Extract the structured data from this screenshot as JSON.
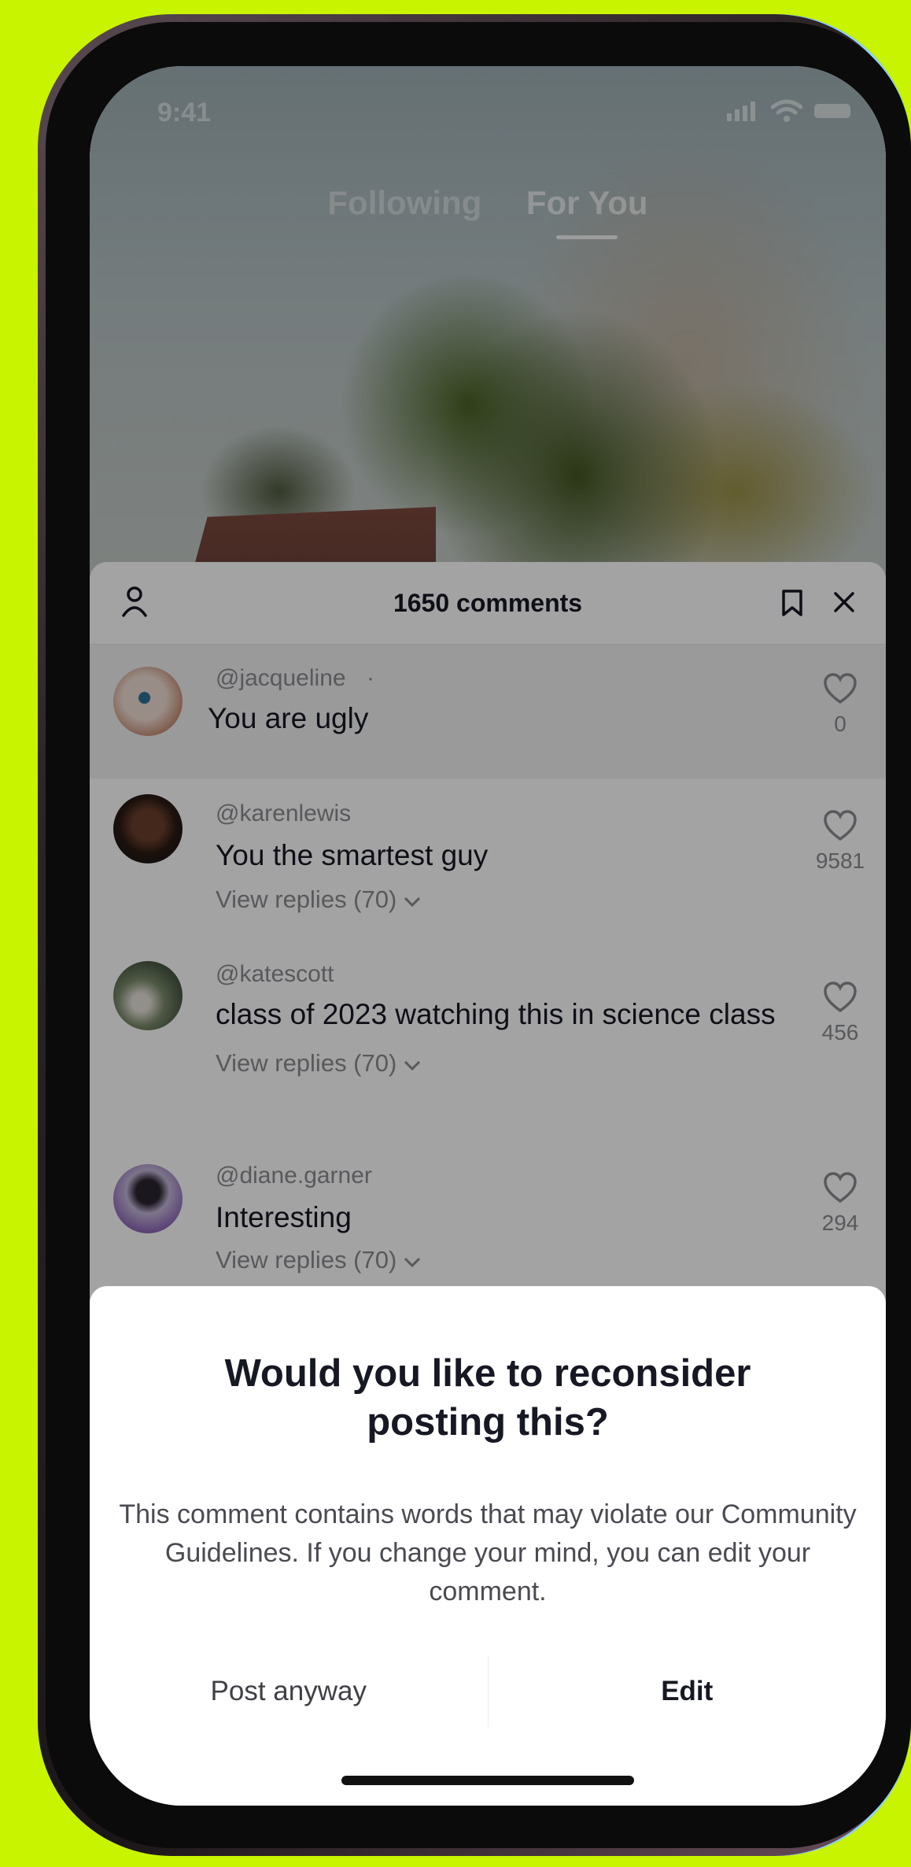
{
  "status_bar": {
    "time": "9:41"
  },
  "feed_tabs": [
    {
      "label": "Following",
      "active": false
    },
    {
      "label": "For You",
      "active": true
    }
  ],
  "comments_sheet": {
    "title": "1650 comments",
    "comments": [
      {
        "handle": "@jacqueline",
        "suffix": "·",
        "text": "You are ugly",
        "likes": "0",
        "replies": ""
      },
      {
        "handle": "@karenlewis",
        "suffix": "",
        "text": "You the smartest guy",
        "likes": "9581",
        "replies": "View replies (70)"
      },
      {
        "handle": "@katescott",
        "suffix": "",
        "text": "class of 2023 watching this in science class",
        "likes": "456",
        "replies": "View replies (70)"
      },
      {
        "handle": "@diane.garner",
        "suffix": "",
        "text": "Interesting",
        "likes": "294",
        "replies": "View replies (70)"
      }
    ]
  },
  "dialog": {
    "title": "Would you like to reconsider posting this?",
    "body": "This comment contains words that may violate our Community Guidelines. If you change your mind, you can edit your comment.",
    "post_anyway_label": "Post anyway",
    "edit_label": "Edit"
  },
  "icons": {
    "profile": "person-icon",
    "bookmark": "bookmark-icon",
    "close": "close-icon",
    "like": "heart-icon"
  },
  "colors": {
    "background": "#c9f400",
    "text_primary": "#161823",
    "text_secondary": "#8a8b91"
  }
}
